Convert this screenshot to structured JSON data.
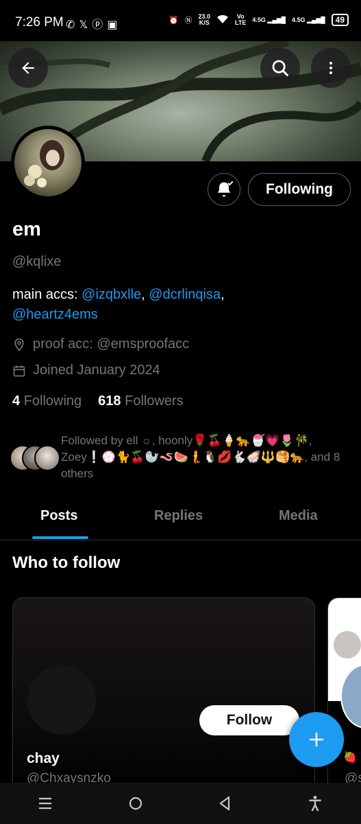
{
  "status_bar": {
    "time": "7:26 PM",
    "app_icons": [
      "whatsapp-icon",
      "x-icon",
      "pinterest-icon",
      "office-icon"
    ],
    "speed_value": "23.0",
    "speed_unit": "K/S",
    "volte_top": "Vo",
    "volte_bottom": "LTE",
    "net1": "4.5G",
    "net2": "4.5G",
    "battery": "49"
  },
  "header": {
    "back_icon": "arrow-left-icon",
    "search_icon": "search-icon",
    "more_icon": "more-vertical-icon"
  },
  "profile": {
    "display_name": "em",
    "handle": "@kqlixe",
    "bio_prefix": "main accs: ",
    "bio_link1": "@izqbxlle",
    "bio_sep1": ", ",
    "bio_link2": "@dcrlinqisa",
    "bio_sep2": ",",
    "bio_link3": "@heartz4ems",
    "location": "proof acc: @emsproofacc",
    "joined": "Joined January 2024",
    "following_count": "4",
    "following_label": "Following",
    "followers_count": "618",
    "followers_label": "Followers",
    "followed_by": "Followed by ell ☼, hoonly🌹🍒🍦🐆🍧💗🌷🎋, Zoey❕💮🐈🍒🦭🪱🍉🧜🐧💋🐇🦪🔱🥞🐆, and 8 others",
    "following_button": "Following"
  },
  "tabs": [
    {
      "label": "Posts",
      "active": true
    },
    {
      "label": "Replies",
      "active": false
    },
    {
      "label": "Media",
      "active": false
    }
  ],
  "who_to_follow": {
    "title": "Who to follow",
    "card": {
      "name": "chay",
      "handle": "@Chxaysnzko",
      "follow_label": "Follow"
    },
    "next_card_handle": "@s"
  },
  "colors": {
    "accent": "#1d9bf0",
    "background": "#000000",
    "secondary_text": "#71767b"
  }
}
